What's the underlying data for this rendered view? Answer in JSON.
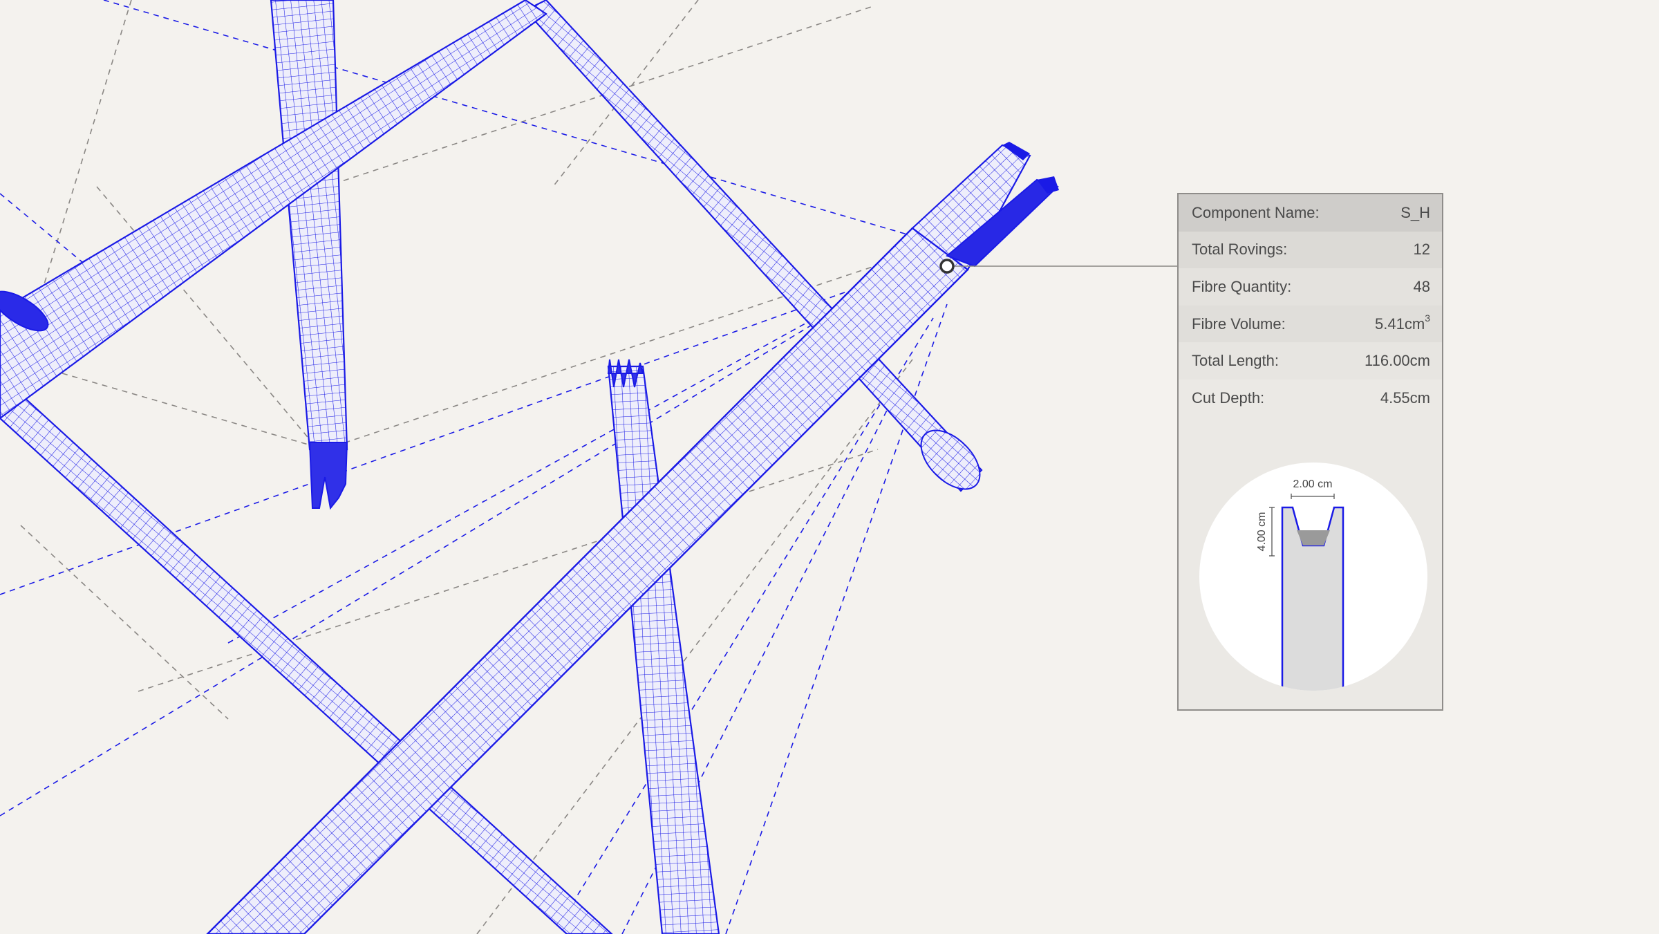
{
  "info_panel": {
    "rows": [
      {
        "label": "Component Name:",
        "value": "S_H"
      },
      {
        "label": "Total Rovings:",
        "value": "12"
      },
      {
        "label": "Fibre Quantity:",
        "value": "48"
      },
      {
        "label": "Fibre Volume:",
        "value": "5.41cm",
        "unit_superscript": "3"
      },
      {
        "label": "Total Length:",
        "value": "116.00cm"
      },
      {
        "label": "Cut Depth:",
        "value": "4.55cm"
      }
    ],
    "section": {
      "width_label": "2.00 cm",
      "height_label": "4.00 cm"
    }
  },
  "colors": {
    "background": "#f4f2ee",
    "mesh": "#1a1ae6",
    "mesh_fill": "#eeeefb",
    "guide_grey": "#8a8784",
    "panel_bg": "#ebe9e5",
    "section_fill": "#dcdcdc",
    "cut_fill": "#9a9a9a"
  }
}
